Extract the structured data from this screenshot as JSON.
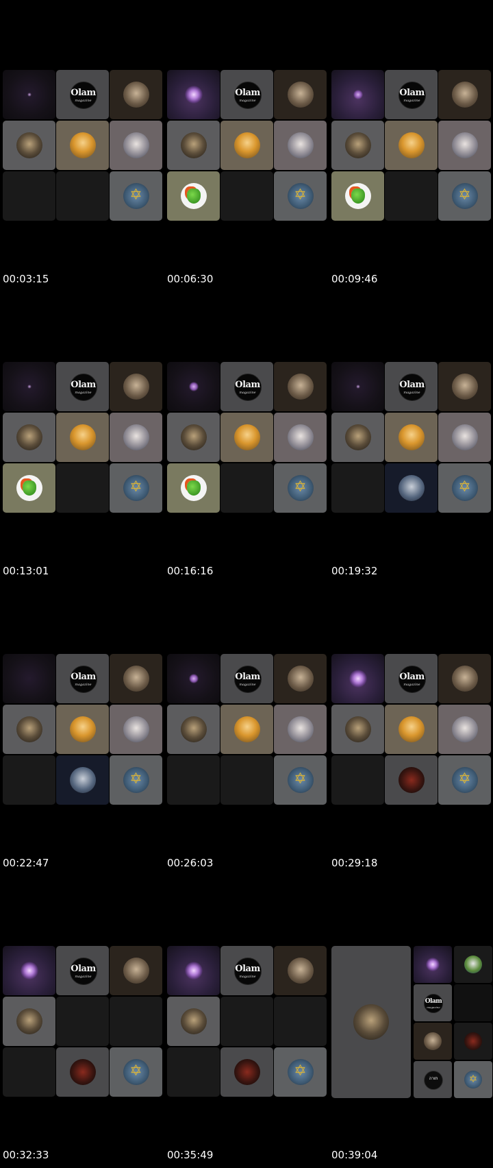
{
  "frames": [
    {
      "timestamp": "00:03:15"
    },
    {
      "timestamp": "00:06:30"
    },
    {
      "timestamp": "00:09:46"
    },
    {
      "timestamp": "00:13:01"
    },
    {
      "timestamp": "00:16:16"
    },
    {
      "timestamp": "00:19:32"
    },
    {
      "timestamp": "00:22:47"
    },
    {
      "timestamp": "00:26:03"
    },
    {
      "timestamp": "00:29:18"
    },
    {
      "timestamp": "00:32:33"
    },
    {
      "timestamp": "00:35:49"
    },
    {
      "timestamp": "00:39:04"
    }
  ],
  "logo_text": "Olam",
  "logo_subtext": "magazine",
  "icons": [
    "olam-logo-icon",
    "skull-avatar-icon",
    "soldier-avatar-icon",
    "cartoon-character-icon",
    "sunglasses-woman-icon",
    "star-of-david-icon",
    "green-monster-icon",
    "hooded-woman-icon",
    "red-figure-icon",
    "purple-flower-icon",
    "torah-logo-icon"
  ]
}
